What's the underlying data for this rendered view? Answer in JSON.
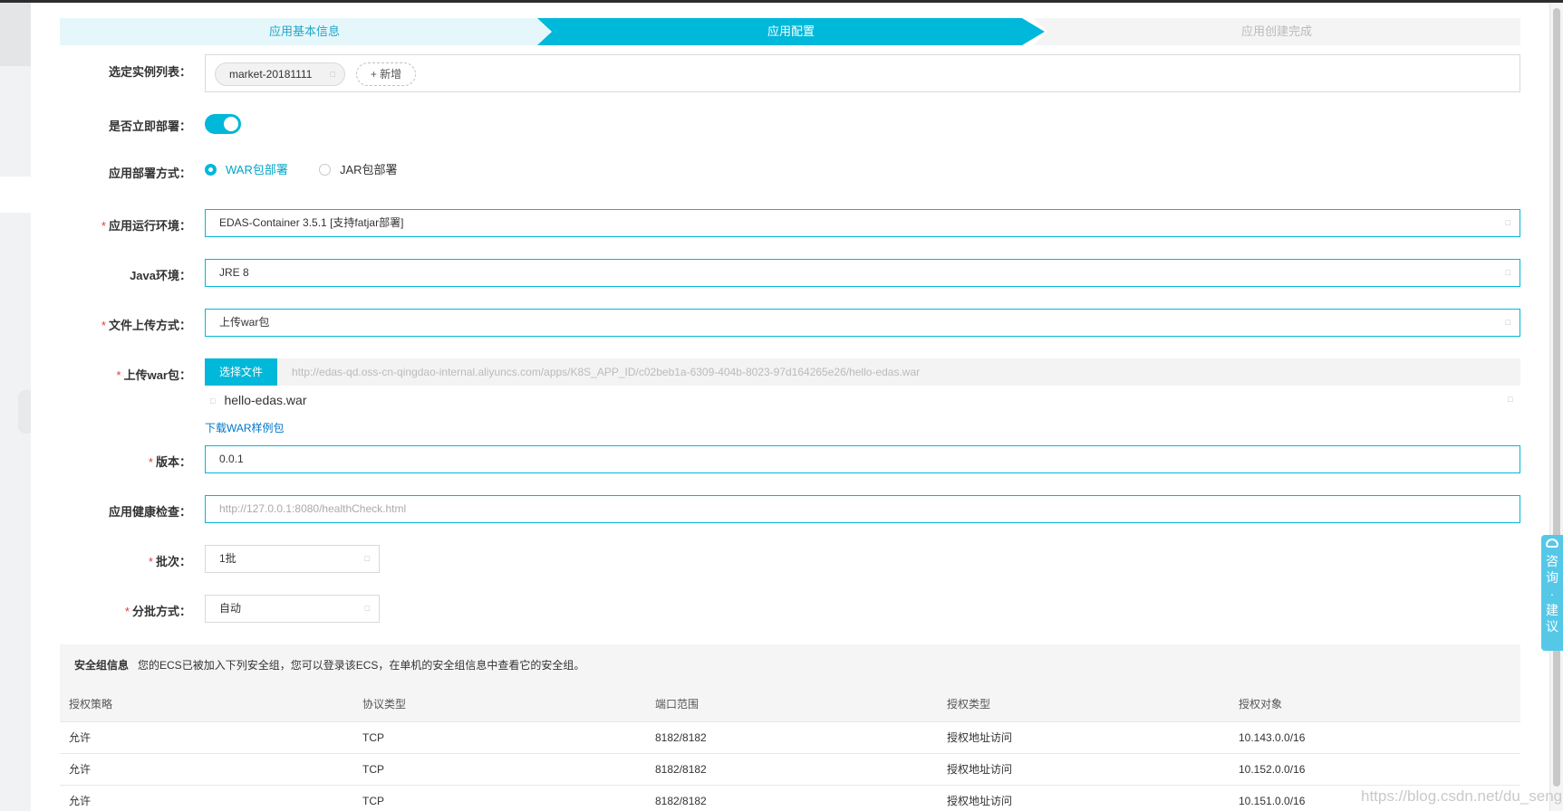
{
  "steps": {
    "step1": "应用基本信息",
    "step2": "应用配置",
    "step3": "应用创建完成"
  },
  "form": {
    "instances": {
      "label": "选定实例列表：",
      "tag": "market-20181111",
      "add_button": "+ 新增"
    },
    "deploy_now": {
      "label": "是否立即部署：",
      "enabled": true
    },
    "deploy_method": {
      "label": "应用部署方式：",
      "options": [
        "WAR包部署",
        "JAR包部署"
      ],
      "selected": "WAR包部署"
    },
    "runtime": {
      "required": "*",
      "label": "应用运行环境：",
      "value": "EDAS-Container 3.5.1 [支持fatjar部署]"
    },
    "java": {
      "label": "Java环境：",
      "value": "JRE 8"
    },
    "upload_method": {
      "required": "*",
      "label": "文件上传方式：",
      "value": "上传war包"
    },
    "upload_war": {
      "required": "*",
      "label": "上传war包：",
      "choose_button": "选择文件",
      "url": "http://edas-qd.oss-cn-qingdao-internal.aliyuncs.com/apps/K8S_APP_ID/c02beb1a-6309-404b-8023-97d164265e26/hello-edas.war",
      "file_name": "hello-edas.war",
      "download_link": "下载WAR样例包"
    },
    "version": {
      "required": "*",
      "label": "版本：",
      "value": "0.0.1"
    },
    "health_check": {
      "label": "应用健康检查：",
      "placeholder": "http://127.0.0.1:8080/healthCheck.html"
    },
    "batch": {
      "required": "*",
      "label": "批次：",
      "value": "1批"
    },
    "batch_mode": {
      "required": "*",
      "label": "分批方式：",
      "value": "自动"
    }
  },
  "security": {
    "title": "安全组信息",
    "desc": "您的ECS已被加入下列安全组，您可以登录该ECS，在单机的安全组信息中查看它的安全组。",
    "columns": [
      "授权策略",
      "协议类型",
      "端口范围",
      "授权类型",
      "授权对象"
    ],
    "rows": [
      [
        "允许",
        "TCP",
        "8182/8182",
        "授权地址访问",
        "10.143.0.0/16"
      ],
      [
        "允许",
        "TCP",
        "8182/8182",
        "授权地址访问",
        "10.152.0.0/16"
      ],
      [
        "允许",
        "TCP",
        "8182/8182",
        "授权地址访问",
        "10.151.0.0/16"
      ]
    ]
  },
  "consult": {
    "chars": [
      "咨",
      "询",
      "·",
      "建",
      "议"
    ]
  },
  "watermark": "https://blog.csdn.net/du_senge",
  "colors": {
    "accent": "#00b8d9",
    "step_done_bg": "#e6f7fb",
    "required": "#e4393c",
    "link": "#0077cc"
  }
}
